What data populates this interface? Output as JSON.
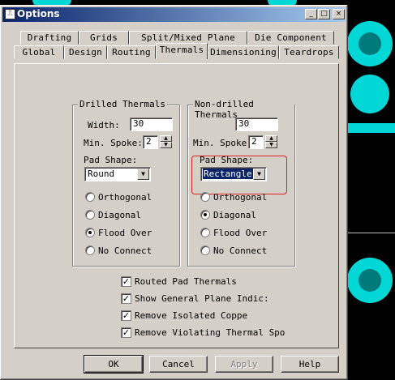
{
  "window": {
    "title": "Options"
  },
  "titlebar_buttons": {
    "minimize": "_",
    "maximize": "□",
    "close": "×"
  },
  "tabs_row1": [
    "Drafting",
    "Grids",
    "Split/Mixed Plane",
    "Die Component"
  ],
  "tabs_row2": [
    "Global",
    "Design",
    "Routing",
    "Thermals",
    "Dimensioning",
    "Teardrops"
  ],
  "active_tab": "Thermals",
  "drilled": {
    "group_label": "Drilled Thermals",
    "width_label": "Width:",
    "width_value": "30",
    "min_spoke_label": "Min. Spoke:",
    "min_spoke_value": "2",
    "pad_shape_label": "Pad Shape:",
    "pad_shape_value": "Round",
    "options": [
      "Orthogonal",
      "Diagonal",
      "Flood Over",
      "No Connect"
    ],
    "selected": "Flood Over"
  },
  "nondrilled": {
    "group_label": "Non-drilled Thermals",
    "width_value": "30",
    "min_spoke_label": "Min. Spoke:",
    "min_spoke_value": "2",
    "pad_shape_label": "Pad Shape:",
    "pad_shape_value": "Rectangle",
    "options": [
      "Orthogonal",
      "Diagonal",
      "Flood Over",
      "No Connect"
    ],
    "selected": "Diagonal"
  },
  "checkboxes": [
    {
      "label": "Routed Pad Thermals",
      "checked": true
    },
    {
      "label": "Show General Plane Indic:",
      "checked": true
    },
    {
      "label": "Remove Isolated Coppe",
      "checked": true
    },
    {
      "label": "Remove Violating Thermal Spo",
      "checked": true
    }
  ],
  "buttons": {
    "ok": "OK",
    "cancel": "Cancel",
    "apply": "Apply",
    "help": "Help"
  },
  "colors": {
    "pcb_pad": "#00d8d8",
    "title_bar": "#0a246a",
    "annotation": "#e02020"
  }
}
